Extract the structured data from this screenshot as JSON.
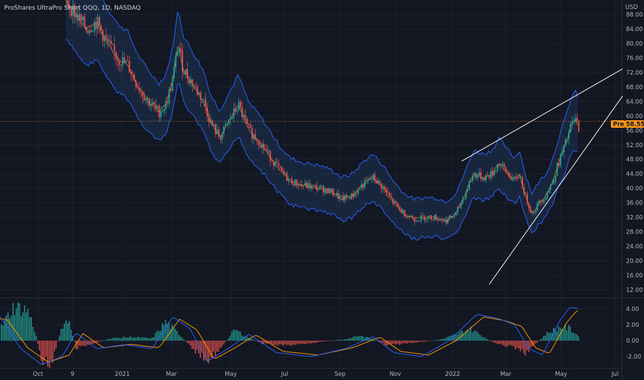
{
  "header": {
    "title": "ProShares UltraPro Short QQQ, 1D, NASDAQ",
    "currency": "USD"
  },
  "badges": {
    "pre_label": "Pre",
    "last_price": "58.55"
  },
  "colors": {
    "background": "#131722",
    "up": "#26a69a",
    "down": "#ef5350",
    "band": "#2962ff",
    "band_fill": "#1e3a5f",
    "basis": "#f7931a",
    "price_line": "#f7931a",
    "trendline": "#ffffff",
    "macd": "#2962ff",
    "signal": "#ff9800"
  },
  "chart_data": [
    {
      "type": "candlestick",
      "title": "ProShares UltraPro Short QQQ, 1D, NASDAQ",
      "ylabel": "USD",
      "ylim": [
        10,
        92
      ],
      "y_ticks": [
        "88.00",
        "84.00",
        "80.00",
        "76.00",
        "72.00",
        "68.00",
        "64.00",
        "60.00",
        "56.00",
        "52.00",
        "48.00",
        "44.00",
        "40.00",
        "36.00",
        "32.00",
        "28.00",
        "24.00",
        "20.00",
        "16.00",
        "12.00"
      ],
      "x_ticks": [
        "Oct",
        "9",
        "2021",
        "Mar",
        "May",
        "Jul",
        "Sep",
        "Nov",
        "2022",
        "Mar",
        "May",
        "Jul"
      ],
      "series": [
        {
          "name": "Price",
          "x": [
            0,
            10,
            20,
            30,
            40,
            50,
            60,
            70,
            80,
            90,
            100,
            110,
            120,
            130,
            140,
            150,
            160,
            170,
            180,
            190,
            200,
            210,
            220,
            230,
            240,
            250,
            260,
            270,
            280,
            290,
            300,
            310,
            320,
            330,
            340,
            350,
            360,
            370,
            380,
            390,
            400,
            410,
            420,
            430,
            440,
            450,
            460,
            470,
            480,
            490,
            500,
            510,
            520,
            530,
            540,
            550,
            560,
            570,
            580,
            590,
            600,
            610,
            620,
            630,
            640,
            650,
            660,
            670,
            680,
            690,
            700,
            710,
            720,
            730,
            740,
            750,
            760,
            770,
            780,
            790,
            800,
            810,
            820,
            830,
            840
          ],
          "close": [
            100,
            97,
            93,
            90,
            88,
            86,
            85,
            83,
            80,
            76,
            70,
            67,
            64,
            61,
            60,
            58,
            58,
            62,
            63,
            66,
            60,
            56,
            54,
            52,
            58,
            62,
            55,
            52,
            48,
            46,
            44,
            42,
            41,
            40,
            40,
            39,
            38,
            37,
            36,
            38,
            40,
            37,
            35,
            33,
            32,
            31,
            31,
            31,
            30,
            30,
            31,
            30,
            32,
            38,
            45,
            46,
            48,
            44,
            48,
            46,
            42,
            36,
            32,
            34,
            38,
            46,
            48,
            50,
            56,
            59,
            58.55,
            null,
            null,
            null,
            null,
            null,
            null,
            null,
            null,
            null,
            null,
            null,
            null,
            null,
            null
          ]
        },
        {
          "name": "Bollinger Upper",
          "values": []
        },
        {
          "name": "Bollinger Lower",
          "values": []
        },
        {
          "name": "Basis",
          "values": []
        }
      ],
      "price_line": 58.55
    },
    {
      "type": "bar",
      "title": "",
      "ylim": [
        -3.2,
        5.2
      ],
      "y_ticks": [
        "4.00",
        "2.00",
        "0.00",
        "-2.00"
      ],
      "series": [
        {
          "name": "Histogram",
          "values": []
        },
        {
          "name": "MACD",
          "values": []
        },
        {
          "name": "Signal",
          "values": []
        }
      ]
    }
  ]
}
